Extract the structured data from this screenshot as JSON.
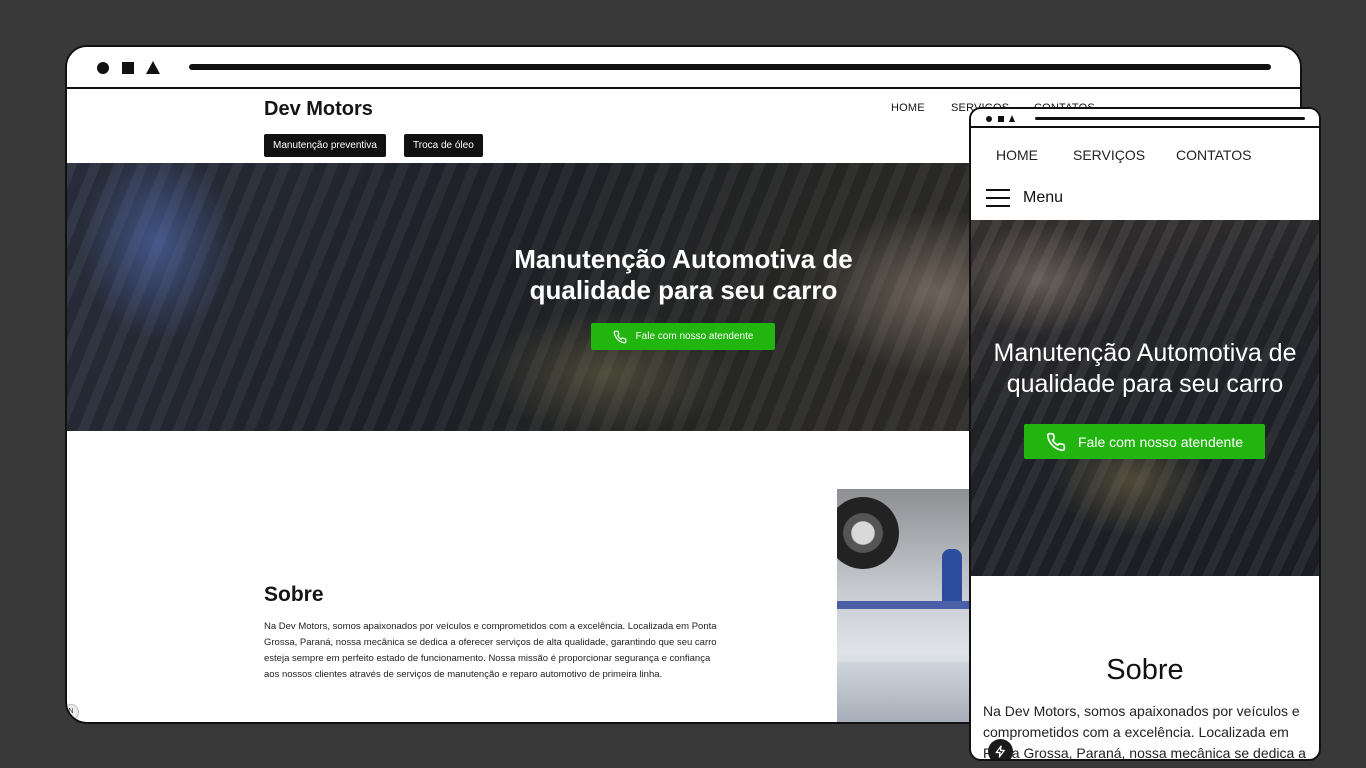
{
  "desktop": {
    "brand": "Dev Motors",
    "nav": [
      "HOME",
      "SERVIÇOS",
      "CONTATOS"
    ],
    "pills": [
      "Manutenção preventiva",
      "Troca de óleo"
    ],
    "hero": {
      "title_line1": "Manutenção Automotiva de",
      "title_line2": "qualidade para seu carro",
      "cta": "Fale com nosso atendente"
    },
    "about": {
      "title": "Sobre",
      "text": "Na Dev Motors, somos apaixonados por veículos e comprometidos com a excelência. Localizada em Ponta Grossa, Paraná, nossa mecânica se dedica a oferecer serviços de alta qualidade, garantindo que seu carro esteja sempre em perfeito estado de funcionamento. Nossa missão é proporcionar segurança e confiança aos nossos clientes através de serviços de manutenção e reparo automotivo de primeira linha."
    }
  },
  "mobile": {
    "nav": [
      "HOME",
      "SERVIÇOS",
      "CONTATOS"
    ],
    "menu_label": "Menu",
    "hero": {
      "title_line1": "Manutenção Automotiva de",
      "title_line2": "qualidade para seu carro",
      "cta": "Fale com nosso atendente"
    },
    "about": {
      "title": "Sobre",
      "text": "Na Dev Motors, somos apaixonados por veículos e comprometidos com a excelência. Localizada em Ponta Grossa, Paraná, nossa mecânica se dedica a"
    }
  },
  "colors": {
    "background": "#393939",
    "accent_green": "#22b510",
    "dark": "#111111"
  },
  "icons": [
    "phone-icon",
    "hamburger-menu-icon",
    "bolt-icon"
  ]
}
